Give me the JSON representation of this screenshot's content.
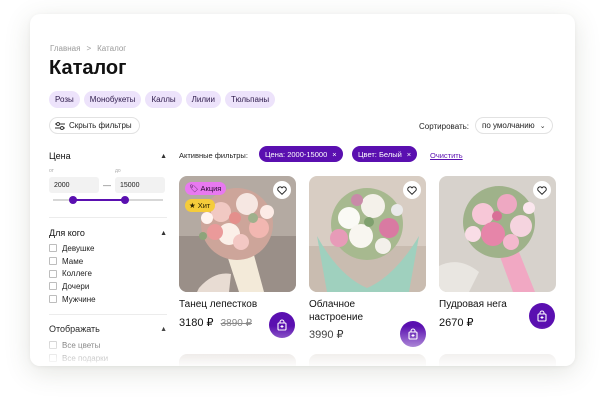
{
  "breadcrumb": {
    "home": "Главная",
    "separator": ">",
    "current": "Каталог"
  },
  "page_title": "Каталог",
  "categories": [
    "Розы",
    "Монобукеты",
    "Каллы",
    "Лилии",
    "Тюльпаны"
  ],
  "toolbar": {
    "hide_filters": "Скрыть фильтры",
    "sort_label": "Сортировать:",
    "sort_value": "по умолчанию"
  },
  "sidebar": {
    "price": {
      "title": "Цена",
      "from_label": "от",
      "to_label": "до",
      "from": "2000",
      "to": "15000"
    },
    "for_whom": {
      "title": "Для кого",
      "items": [
        "Девушке",
        "Маме",
        "Коллеге",
        "Дочери",
        "Мужчине"
      ]
    },
    "display": {
      "title": "Отображать",
      "items": [
        "Все цветы",
        "Все подарки"
      ]
    }
  },
  "active_filters": {
    "label": "Активные фильтры:",
    "chips": [
      "Цена: 2000-15000",
      "Цвет: Белый"
    ],
    "clear": "Очистить"
  },
  "products": [
    {
      "name": "Танец лепестков",
      "price": "3180 ₽",
      "old_price": "3890 ₽",
      "badges": [
        "Акция",
        "Хит"
      ]
    },
    {
      "name": "Облачное настроение",
      "price": "3990 ₽",
      "old_price": "",
      "badges": []
    },
    {
      "name": "Пудровая нега",
      "price": "2670 ₽",
      "old_price": "",
      "badges": []
    }
  ],
  "colors": {
    "accent": "#5a0fb0",
    "chip_bg": "#ede3fb",
    "badge_sale": "#e879f0",
    "badge_hit": "#f5cc3a"
  }
}
